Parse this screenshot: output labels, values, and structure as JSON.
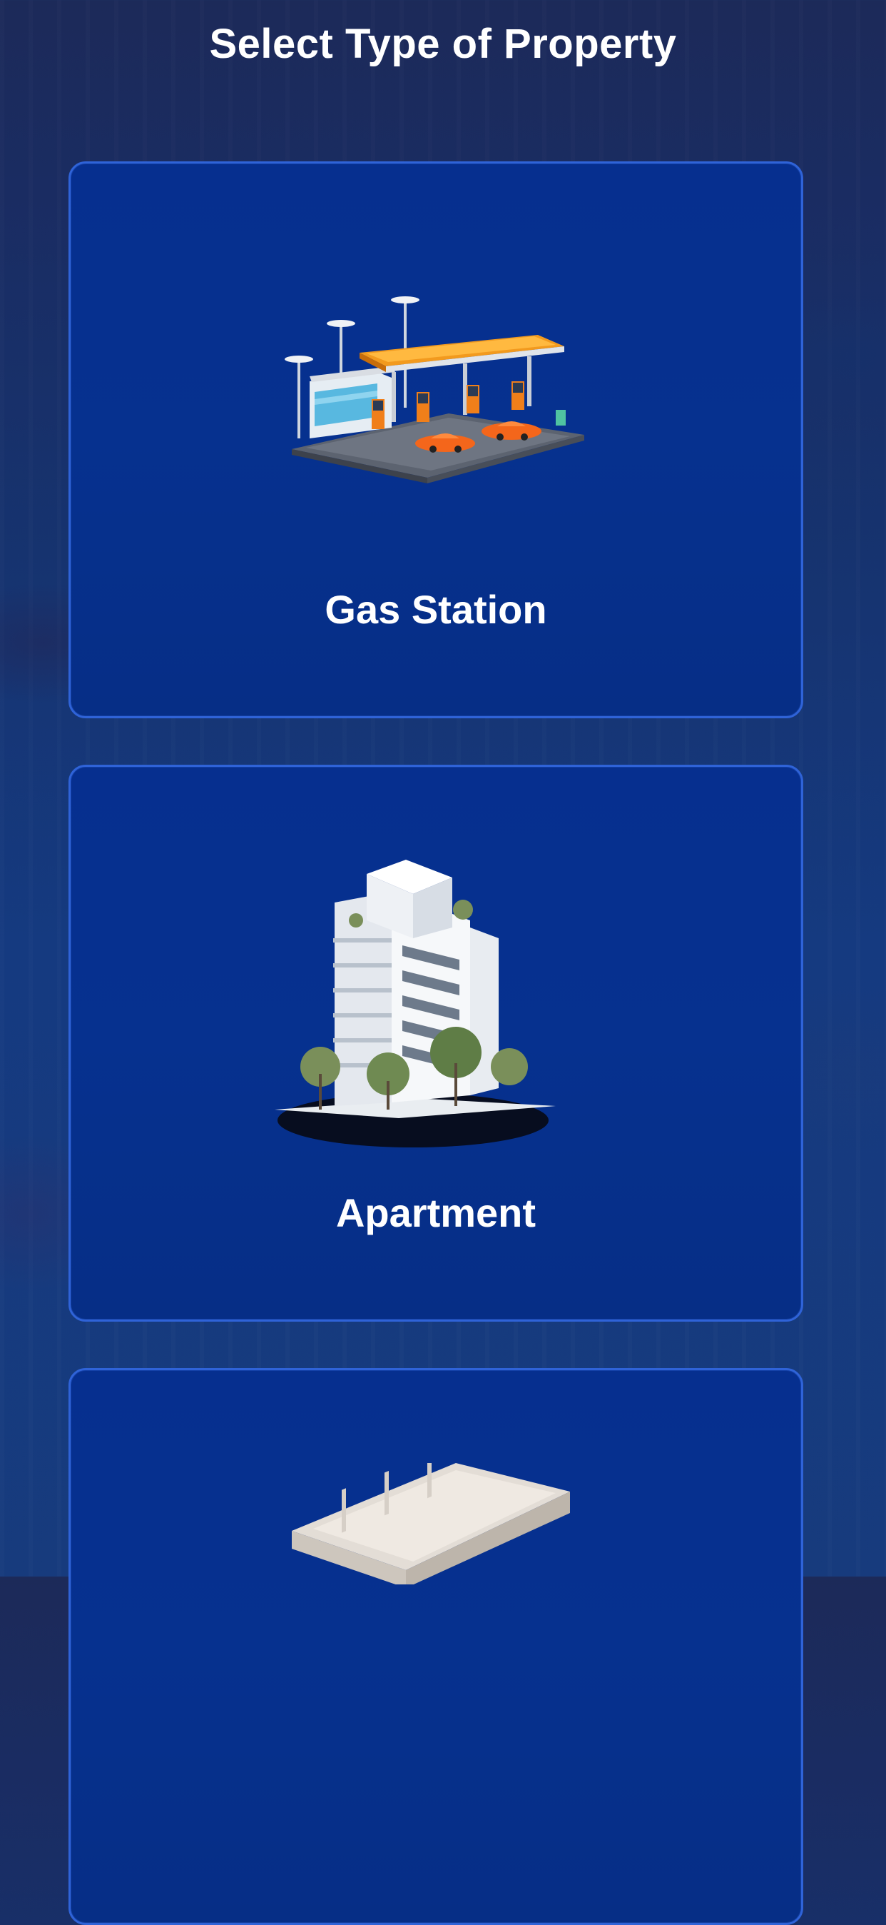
{
  "header": {
    "title": "Select Type of Property"
  },
  "property_types": [
    {
      "label": "Gas Station",
      "icon": "gas-station-illustration"
    },
    {
      "label": "Apartment",
      "icon": "apartment-building-illustration"
    },
    {
      "label": "",
      "icon": "warehouse-illustration"
    }
  ],
  "colors": {
    "background": "#16336f",
    "card_fill": "#06318f",
    "card_border": "#2f63d8",
    "text": "#ffffff"
  }
}
